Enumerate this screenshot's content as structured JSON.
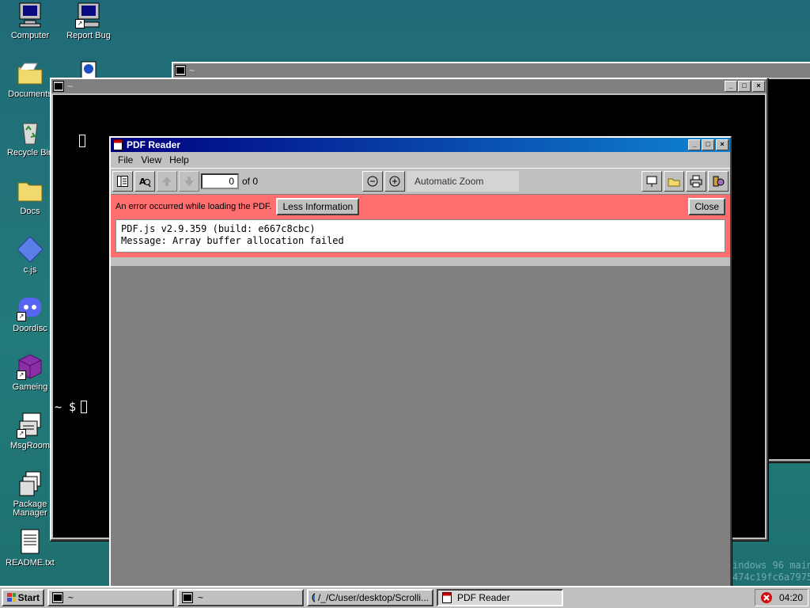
{
  "desktop": {
    "icons": [
      {
        "label": "Computer",
        "icon": "computer-icon"
      },
      {
        "label": "Report Bug",
        "icon": "report-bug-icon"
      },
      {
        "label": "Documents",
        "icon": "folder-icon"
      },
      {
        "label": "Recycle Bin",
        "icon": "recycle-bin-icon"
      },
      {
        "label": "Docs",
        "icon": "folder-icon"
      },
      {
        "label": "c.js",
        "icon": "js-file-icon"
      },
      {
        "label": "Doordisc",
        "icon": "discord-icon"
      },
      {
        "label": "Gameing",
        "icon": "game-cube-icon"
      },
      {
        "label": "MsgRoom",
        "icon": "msgroom-icon"
      },
      {
        "label": "Package Manager",
        "icon": "package-manager-icon"
      },
      {
        "label": "README.txt",
        "icon": "text-file-icon"
      }
    ],
    "watermark": [
      "indows 96 main",
      "474c19fc6a7975"
    ]
  },
  "terminal_back": {
    "title": "~"
  },
  "terminal_front": {
    "title": "~",
    "prompt": "~ $"
  },
  "pdf_reader": {
    "title": "PDF Reader",
    "menu": [
      "File",
      "View",
      "Help"
    ],
    "page_number": "0",
    "page_total": "of 0",
    "zoom": "Automatic Zoom",
    "error": {
      "message": "An error occurred while loading the PDF.",
      "less_info_label": "Less Information",
      "close_label": "Close",
      "details_line1": "PDF.js v2.9.359 (build: e667c8cbc)",
      "details_line2": "Message: Array buffer allocation failed"
    }
  },
  "taskbar": {
    "start_label": "Start",
    "items": [
      {
        "label": "~",
        "pressed": false
      },
      {
        "label": "~",
        "pressed": false
      },
      {
        "label": "/_/C/user/desktop/Scrolli...",
        "pressed": false
      },
      {
        "label": "PDF Reader",
        "pressed": true
      }
    ],
    "clock": "04:20"
  }
}
